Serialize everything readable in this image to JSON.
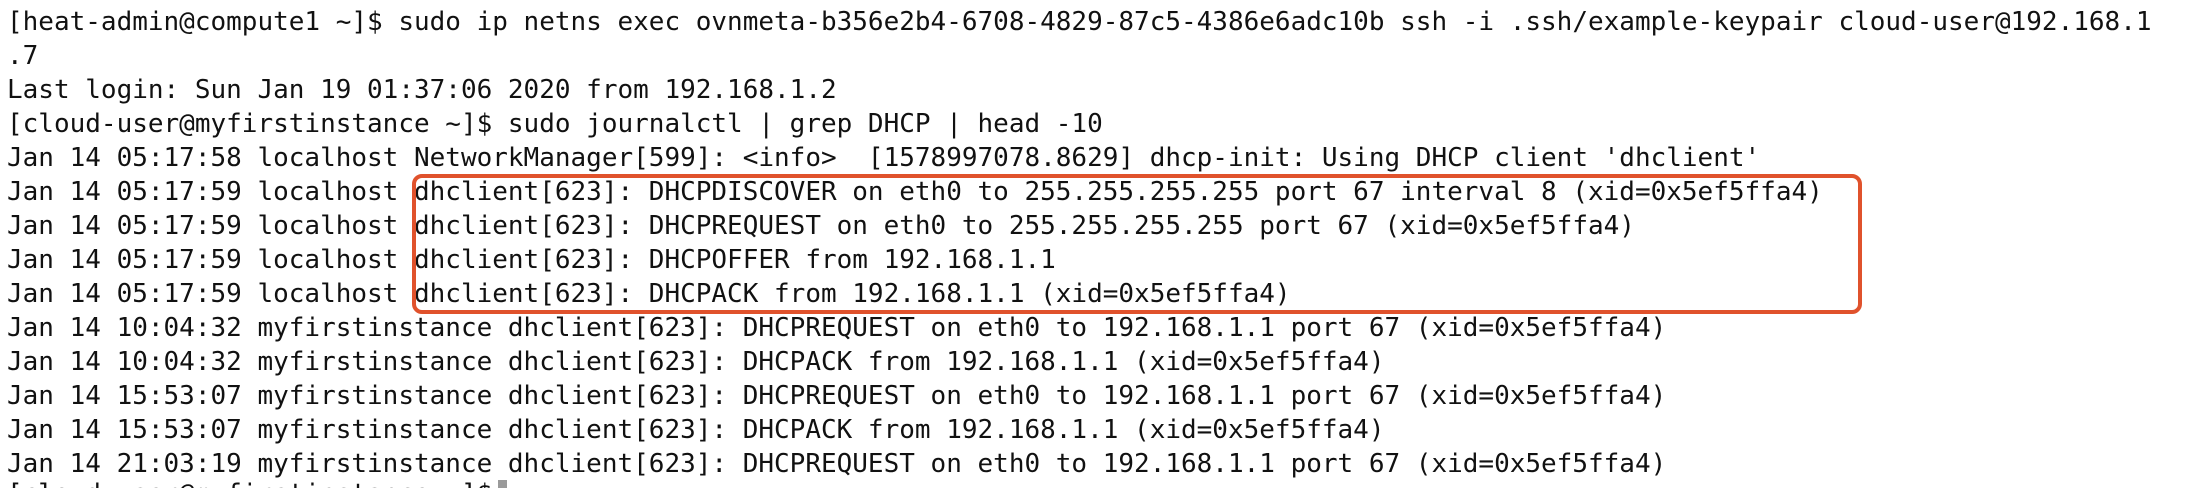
{
  "terminal": {
    "background": "#ffffff",
    "text_color": "#111111",
    "highlight_color": "#e0522c",
    "lines": [
      "[heat-admin@compute1 ~]$ sudo ip netns exec ovnmeta-b356e2b4-6708-4829-87c5-4386e6adc10b ssh -i .ssh/example-keypair cloud-user@192.168.1",
      ".7",
      "Last login: Sun Jan 19 01:37:06 2020 from 192.168.1.2",
      "[cloud-user@myfirstinstance ~]$ sudo journalctl | grep DHCP | head -10",
      "Jan 14 05:17:58 localhost NetworkManager[599]: <info>  [1578997078.8629] dhcp-init: Using DHCP client 'dhclient'",
      "Jan 14 05:17:59 localhost dhclient[623]: DHCPDISCOVER on eth0 to 255.255.255.255 port 67 interval 8 (xid=0x5ef5ffa4)",
      "Jan 14 05:17:59 localhost dhclient[623]: DHCPREQUEST on eth0 to 255.255.255.255 port 67 (xid=0x5ef5ffa4)",
      "Jan 14 05:17:59 localhost dhclient[623]: DHCPOFFER from 192.168.1.1",
      "Jan 14 05:17:59 localhost dhclient[623]: DHCPACK from 192.168.1.1 (xid=0x5ef5ffa4)",
      "Jan 14 10:04:32 myfirstinstance dhclient[623]: DHCPREQUEST on eth0 to 192.168.1.1 port 67 (xid=0x5ef5ffa4)",
      "Jan 14 10:04:32 myfirstinstance dhclient[623]: DHCPACK from 192.168.1.1 (xid=0x5ef5ffa4)",
      "Jan 14 15:53:07 myfirstinstance dhclient[623]: DHCPREQUEST on eth0 to 192.168.1.1 port 67 (xid=0x5ef5ffa4)",
      "Jan 14 15:53:07 myfirstinstance dhclient[623]: DHCPACK from 192.168.1.1 (xid=0x5ef5ffa4)",
      "Jan 14 21:03:19 myfirstinstance dhclient[623]: DHCPREQUEST on eth0 to 192.168.1.1 port 67 (xid=0x5ef5ffa4)"
    ],
    "last_prompt": "[cloud-user@myfirstinstance ~]$"
  }
}
